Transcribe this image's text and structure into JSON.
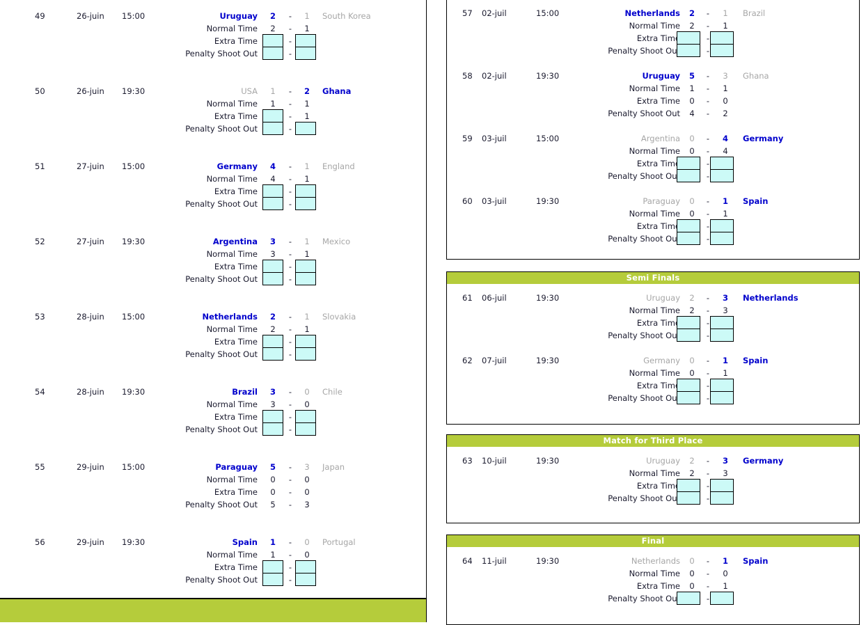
{
  "meta": {
    "labels": {
      "normal_time": "Normal Time",
      "extra_time": "Extra Time",
      "penalty_shoot_out": "Penalty Shoot Out",
      "dash": "-"
    },
    "colors": {
      "winner": "#0000cc",
      "loser": "#a6a6a6",
      "section_header_bg": "#b5cc3b",
      "input_cell_bg": "#ccfaf7",
      "border": "#000000",
      "footer_bar": "#b5cc3b"
    }
  },
  "left_column": {
    "section_title": "",
    "matches": [
      {
        "no": "49",
        "date": "26-juin",
        "time": "15:00",
        "home": "Uruguay",
        "away": "South Korea",
        "home_state": "win",
        "away_state": "lose",
        "agg_home": "2",
        "agg_away": "1",
        "normal": {
          "home": "2",
          "away": "1",
          "home_box": false,
          "away_box": false
        },
        "extra": {
          "home": "",
          "away": "",
          "home_box": true,
          "away_box": true
        },
        "penalty": {
          "home": "",
          "away": "",
          "home_box": true,
          "away_box": true
        }
      },
      {
        "no": "50",
        "date": "26-juin",
        "time": "19:30",
        "home": "USA",
        "away": "Ghana",
        "home_state": "lose",
        "away_state": "win",
        "agg_home": "1",
        "agg_away": "2",
        "normal": {
          "home": "1",
          "away": "1",
          "home_box": false,
          "away_box": false
        },
        "extra": {
          "home": "",
          "away": "1",
          "home_box": true,
          "away_box": false
        },
        "penalty": {
          "home": "",
          "away": "",
          "home_box": true,
          "away_box": true
        }
      },
      {
        "no": "51",
        "date": "27-juin",
        "time": "15:00",
        "home": "Germany",
        "away": "England",
        "home_state": "win",
        "away_state": "lose",
        "agg_home": "4",
        "agg_away": "1",
        "normal": {
          "home": "4",
          "away": "1",
          "home_box": false,
          "away_box": false
        },
        "extra": {
          "home": "",
          "away": "",
          "home_box": true,
          "away_box": true
        },
        "penalty": {
          "home": "",
          "away": "",
          "home_box": true,
          "away_box": true
        }
      },
      {
        "no": "52",
        "date": "27-juin",
        "time": "19:30",
        "home": "Argentina",
        "away": "Mexico",
        "home_state": "win",
        "away_state": "lose",
        "agg_home": "3",
        "agg_away": "1",
        "normal": {
          "home": "3",
          "away": "1",
          "home_box": false,
          "away_box": false
        },
        "extra": {
          "home": "",
          "away": "",
          "home_box": true,
          "away_box": true
        },
        "penalty": {
          "home": "",
          "away": "",
          "home_box": true,
          "away_box": true
        }
      },
      {
        "no": "53",
        "date": "28-juin",
        "time": "15:00",
        "home": "Netherlands",
        "away": "Slovakia",
        "home_state": "win",
        "away_state": "lose",
        "agg_home": "2",
        "agg_away": "1",
        "normal": {
          "home": "2",
          "away": "1",
          "home_box": false,
          "away_box": false
        },
        "extra": {
          "home": "",
          "away": "",
          "home_box": true,
          "away_box": true
        },
        "penalty": {
          "home": "",
          "away": "",
          "home_box": true,
          "away_box": true
        }
      },
      {
        "no": "54",
        "date": "28-juin",
        "time": "19:30",
        "home": "Brazil",
        "away": "Chile",
        "home_state": "win",
        "away_state": "lose",
        "agg_home": "3",
        "agg_away": "0",
        "normal": {
          "home": "3",
          "away": "0",
          "home_box": false,
          "away_box": false
        },
        "extra": {
          "home": "",
          "away": "",
          "home_box": true,
          "away_box": true
        },
        "penalty": {
          "home": "",
          "away": "",
          "home_box": true,
          "away_box": true
        }
      },
      {
        "no": "55",
        "date": "29-juin",
        "time": "15:00",
        "home": "Paraguay",
        "away": "Japan",
        "home_state": "win",
        "away_state": "lose",
        "agg_home": "5",
        "agg_away": "3",
        "normal": {
          "home": "0",
          "away": "0",
          "home_box": false,
          "away_box": false
        },
        "extra": {
          "home": "0",
          "away": "0",
          "home_box": false,
          "away_box": false
        },
        "penalty": {
          "home": "5",
          "away": "3",
          "home_box": false,
          "away_box": false
        }
      },
      {
        "no": "56",
        "date": "29-juin",
        "time": "19:30",
        "home": "Spain",
        "away": "Portugal",
        "home_state": "win",
        "away_state": "lose",
        "agg_home": "1",
        "agg_away": "0",
        "normal": {
          "home": "1",
          "away": "0",
          "home_box": false,
          "away_box": false
        },
        "extra": {
          "home": "",
          "away": "",
          "home_box": true,
          "away_box": true
        },
        "penalty": {
          "home": "",
          "away": "",
          "home_box": true,
          "away_box": true
        }
      }
    ]
  },
  "right_column": {
    "sections": [
      {
        "title": "",
        "has_header": false,
        "matches": [
          {
            "no": "57",
            "date": "02-juil",
            "time": "15:00",
            "home": "Netherlands",
            "away": "Brazil",
            "home_state": "win",
            "away_state": "lose",
            "agg_home": "2",
            "agg_away": "1",
            "normal": {
              "home": "2",
              "away": "1",
              "home_box": false,
              "away_box": false
            },
            "extra": {
              "home": "",
              "away": "",
              "home_box": true,
              "away_box": true
            },
            "penalty": {
              "home": "",
              "away": "",
              "home_box": true,
              "away_box": true
            }
          },
          {
            "no": "58",
            "date": "02-juil",
            "time": "19:30",
            "home": "Uruguay",
            "away": "Ghana",
            "home_state": "win",
            "away_state": "lose",
            "agg_home": "5",
            "agg_away": "3",
            "normal": {
              "home": "1",
              "away": "1",
              "home_box": false,
              "away_box": false
            },
            "extra": {
              "home": "0",
              "away": "0",
              "home_box": false,
              "away_box": false
            },
            "penalty": {
              "home": "4",
              "away": "2",
              "home_box": false,
              "away_box": false
            }
          },
          {
            "no": "59",
            "date": "03-juil",
            "time": "15:00",
            "home": "Argentina",
            "away": "Germany",
            "home_state": "lose",
            "away_state": "win",
            "agg_home": "0",
            "agg_away": "4",
            "normal": {
              "home": "0",
              "away": "4",
              "home_box": false,
              "away_box": false
            },
            "extra": {
              "home": "",
              "away": "",
              "home_box": true,
              "away_box": true
            },
            "penalty": {
              "home": "",
              "away": "",
              "home_box": true,
              "away_box": true
            }
          },
          {
            "no": "60",
            "date": "03-juil",
            "time": "19:30",
            "home": "Paraguay",
            "away": "Spain",
            "home_state": "lose",
            "away_state": "win",
            "agg_home": "0",
            "agg_away": "1",
            "normal": {
              "home": "0",
              "away": "1",
              "home_box": false,
              "away_box": false
            },
            "extra": {
              "home": "",
              "away": "",
              "home_box": true,
              "away_box": true
            },
            "penalty": {
              "home": "",
              "away": "",
              "home_box": true,
              "away_box": true
            }
          }
        ]
      },
      {
        "title": "Semi Finals",
        "has_header": true,
        "matches": [
          {
            "no": "61",
            "date": "06-juil",
            "time": "19:30",
            "home": "Uruguay",
            "away": "Netherlands",
            "home_state": "lose",
            "away_state": "win",
            "agg_home": "2",
            "agg_away": "3",
            "normal": {
              "home": "2",
              "away": "3",
              "home_box": false,
              "away_box": false
            },
            "extra": {
              "home": "",
              "away": "",
              "home_box": true,
              "away_box": true
            },
            "penalty": {
              "home": "",
              "away": "",
              "home_box": true,
              "away_box": true
            }
          },
          {
            "no": "62",
            "date": "07-juil",
            "time": "19:30",
            "home": "Germany",
            "away": "Spain",
            "home_state": "lose",
            "away_state": "win",
            "agg_home": "0",
            "agg_away": "1",
            "normal": {
              "home": "0",
              "away": "1",
              "home_box": false,
              "away_box": false
            },
            "extra": {
              "home": "",
              "away": "",
              "home_box": true,
              "away_box": true
            },
            "penalty": {
              "home": "",
              "away": "",
              "home_box": true,
              "away_box": true
            }
          }
        ]
      },
      {
        "title": "Match for Third Place",
        "has_header": true,
        "matches": [
          {
            "no": "63",
            "date": "10-juil",
            "time": "19:30",
            "home": "Uruguay",
            "away": "Germany",
            "home_state": "lose",
            "away_state": "win",
            "agg_home": "2",
            "agg_away": "3",
            "normal": {
              "home": "2",
              "away": "3",
              "home_box": false,
              "away_box": false
            },
            "extra": {
              "home": "",
              "away": "",
              "home_box": true,
              "away_box": true
            },
            "penalty": {
              "home": "",
              "away": "",
              "home_box": true,
              "away_box": true
            }
          }
        ]
      },
      {
        "title": "Final",
        "has_header": true,
        "matches": [
          {
            "no": "64",
            "date": "11-juil",
            "time": "19:30",
            "home": "Netherlands",
            "away": "Spain",
            "home_state": "lose",
            "away_state": "win",
            "agg_home": "0",
            "agg_away": "1",
            "normal": {
              "home": "0",
              "away": "0",
              "home_box": false,
              "away_box": false
            },
            "extra": {
              "home": "0",
              "away": "1",
              "home_box": false,
              "away_box": false
            },
            "penalty": {
              "home": "",
              "away": "",
              "home_box": true,
              "away_box": true
            }
          }
        ]
      }
    ]
  }
}
